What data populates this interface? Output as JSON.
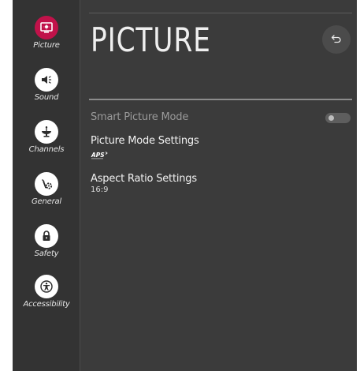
{
  "sidebar": {
    "items": [
      {
        "label": "Picture",
        "icon": "picture-icon",
        "active": true
      },
      {
        "label": "Sound",
        "icon": "speaker-icon",
        "active": false
      },
      {
        "label": "Channels",
        "icon": "satellite-dish-icon",
        "active": false
      },
      {
        "label": "General",
        "icon": "tools-icon",
        "active": false
      },
      {
        "label": "Safety",
        "icon": "lock-icon",
        "active": false
      },
      {
        "label": "Accessibility",
        "icon": "accessibility-icon",
        "active": false
      }
    ]
  },
  "main": {
    "title": "PICTURE",
    "back_icon": "back-arrow-icon",
    "settings": [
      {
        "label": "Smart Picture Mode",
        "enabled": false
      },
      {
        "label": "Picture Mode Settings",
        "value_logo": "APS"
      },
      {
        "label": "Aspect Ratio Settings",
        "value": "16:9"
      }
    ]
  },
  "colors": {
    "accent": "#c1124a",
    "background": "#3b3b3b",
    "sidebar": "#333333"
  }
}
